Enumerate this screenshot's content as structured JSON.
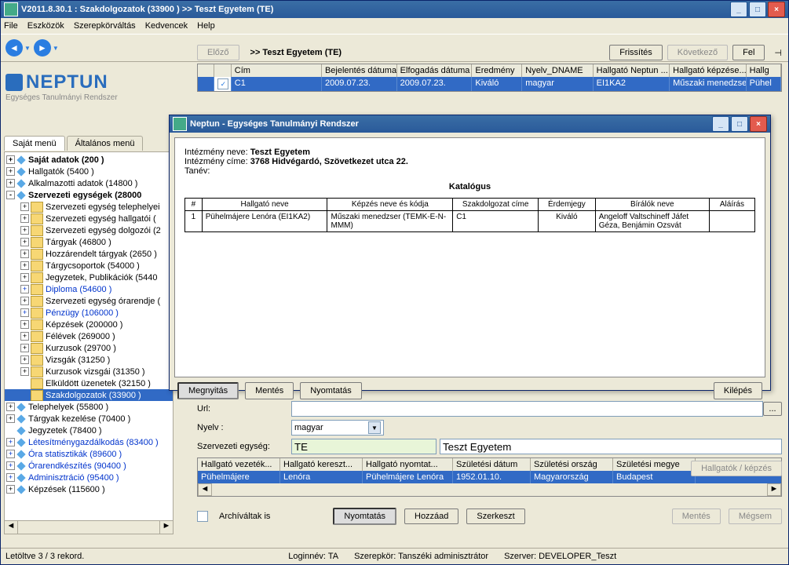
{
  "main_window": {
    "title": "V2011.8.30.1 : Szakdolgozatok (33900  )  >> Teszt Egyetem  (TE)",
    "menu": [
      "File",
      "Eszközök",
      "Szerepkörváltás",
      "Kedvencek",
      "Help"
    ]
  },
  "logo": {
    "brand": "NEPTUN",
    "sub": "Egységes Tanulmányi Rendszer"
  },
  "tabs": {
    "own": "Saját menü",
    "general": "Általános menü"
  },
  "tree": [
    {
      "d": 0,
      "t": "+",
      "i": "diamond",
      "label": "Saját adatok (200  )",
      "bold": true
    },
    {
      "d": 0,
      "t": "+",
      "i": "diamond",
      "label": "Hallgatók (5400  )"
    },
    {
      "d": 0,
      "t": "+",
      "i": "diamond",
      "label": "Alkalmazotti adatok (14800  )"
    },
    {
      "d": 0,
      "t": "-",
      "i": "diamond",
      "label": "Szervezeti egységek (28000",
      "bold": true
    },
    {
      "d": 1,
      "t": "+",
      "i": "f",
      "label": "Szervezeti egység telephelyei"
    },
    {
      "d": 1,
      "t": "+",
      "i": "f",
      "label": "Szervezeti egység hallgatói ("
    },
    {
      "d": 1,
      "t": "+",
      "i": "f",
      "label": "Szervezeti egység dolgozói (2"
    },
    {
      "d": 1,
      "t": "+",
      "i": "f",
      "label": "Tárgyak (46800  )"
    },
    {
      "d": 1,
      "t": "+",
      "i": "f",
      "label": "Hozzárendelt tárgyak (2650  )"
    },
    {
      "d": 1,
      "t": "+",
      "i": "f",
      "label": "Tárgycsoportok (54000  )"
    },
    {
      "d": 1,
      "t": "+",
      "i": "f",
      "label": "Jegyzetek, Publikációk (5440"
    },
    {
      "d": 1,
      "t": "+",
      "i": "f",
      "label": "Diploma (54600  )",
      "link": true
    },
    {
      "d": 1,
      "t": "+",
      "i": "f",
      "label": "Szervezeti egység órarendje ("
    },
    {
      "d": 1,
      "t": "+",
      "i": "f",
      "label": "Pénzügy (106000  )",
      "link": true
    },
    {
      "d": 1,
      "t": "+",
      "i": "f",
      "label": "Képzések (200000  )"
    },
    {
      "d": 1,
      "t": "+",
      "i": "f",
      "label": "Félévek (269000  )"
    },
    {
      "d": 1,
      "t": "+",
      "i": "f",
      "label": "Kurzusok (29700  )"
    },
    {
      "d": 1,
      "t": "+",
      "i": "f",
      "label": "Vizsgák (31250  )"
    },
    {
      "d": 1,
      "t": "+",
      "i": "f",
      "label": "Kurzusok vizsgái (31350  )"
    },
    {
      "d": 1,
      "t": "",
      "i": "f",
      "label": "Elküldött üzenetek (32150  )"
    },
    {
      "d": 1,
      "t": "",
      "i": "f",
      "label": "Szakdolgozatok (33900  )",
      "sel": true
    },
    {
      "d": 0,
      "t": "+",
      "i": "diamond",
      "label": "Telephelyek (55800  )"
    },
    {
      "d": 0,
      "t": "+",
      "i": "diamond",
      "label": "Tárgyak kezelése (70400  )"
    },
    {
      "d": 0,
      "t": "",
      "i": "diamond",
      "label": "Jegyzetek (78400  )"
    },
    {
      "d": 0,
      "t": "+",
      "i": "diamond",
      "label": "Létesítménygazdálkodás (83400  )",
      "link": true
    },
    {
      "d": 0,
      "t": "+",
      "i": "diamond",
      "label": "Óra statisztikák (89600  )",
      "link": true
    },
    {
      "d": 0,
      "t": "+",
      "i": "diamond",
      "label": "Órarendkészítés (90400  )",
      "link": true
    },
    {
      "d": 0,
      "t": "+",
      "i": "diamond",
      "label": "Adminisztráció (95400  )",
      "link": true
    },
    {
      "d": 0,
      "t": "+",
      "i": "diamond",
      "label": "Képzések (115600  )"
    }
  ],
  "grid_top": {
    "prev": "Előző",
    "path": ">>  Teszt Egyetem  (TE)",
    "refresh": "Frissítés",
    "next": "Következő",
    "up": "Fel"
  },
  "grid": {
    "headers": [
      "",
      "",
      "Cím",
      "Bejelentés dátuma",
      "Elfogadás dátuma",
      "Eredmény",
      "Nyelv_DNAME",
      "Hallgató Neptun ...",
      "Hallgató képzése...",
      "Hallg"
    ],
    "row": [
      "",
      "✓",
      "C1",
      "2009.07.23.",
      "2009.07.23.",
      "Kiváló",
      "magyar",
      "EI1KA2",
      "Műszaki menedzser",
      "Pühel"
    ]
  },
  "form": {
    "url_lbl": "Url:",
    "url": "",
    "lang_lbl": "Nyelv :",
    "lang": "magyar",
    "org_lbl": "Szervezeti egység:",
    "org_code": "TE",
    "org_name": "Teszt Egyetem"
  },
  "subgrid": {
    "headers": [
      "Hallgató vezeték...",
      "Hallgató kereszt...",
      "Hallgató nyomtat...",
      "Születési dátum",
      "Születési ország",
      "Születési megye"
    ],
    "row": [
      "Pühelmájere",
      "Lenóra",
      "Pühelmájere Lenóra",
      "1952.01.10.",
      "Magyarország",
      "Budapest"
    ]
  },
  "buttons": {
    "hallgato": "Hallgatók / képzés",
    "archive": "Archíváltak is",
    "print": "Nyomtatás",
    "add": "Hozzáad",
    "edit": "Szerkeszt",
    "save": "Mentés",
    "cancel": "Mégsem"
  },
  "status": {
    "left": "Letöltve 3 / 3 rekord.",
    "login": "Loginnév: TA",
    "role": "Szerepkör: Tanszéki adminisztrátor",
    "server": "Szerver: DEVELOPER_Teszt"
  },
  "dialog": {
    "title": "Neptun - Egységes Tanulmányi Rendszer",
    "inst_lbl": "Intézmény neve:",
    "inst": "Teszt Egyetem",
    "addr_lbl": "Intézmény címe:",
    "addr": "3768 Hidvégardó, Szövetkezet utca 22.",
    "year_lbl": "Tanév:",
    "katalog": "Katalógus",
    "th": [
      "#",
      "Hallgató neve",
      "Képzés neve és kódja",
      "Szakdolgozat címe",
      "Érdemjegy",
      "Bírálók neve",
      "Aláírás"
    ],
    "td": [
      "1",
      "Pühelmájere Lenóra (EI1KA2)",
      "Műszaki menedzser (TEMK-E-N-MMM)",
      "C1",
      "Kiváló",
      "Angeloff Valtschineff Jáfet Géza, Benjámin Ozsvát",
      ""
    ],
    "open": "Megnyitás",
    "saveb": "Mentés",
    "printb": "Nyomtatás",
    "exit": "Kilépés"
  }
}
